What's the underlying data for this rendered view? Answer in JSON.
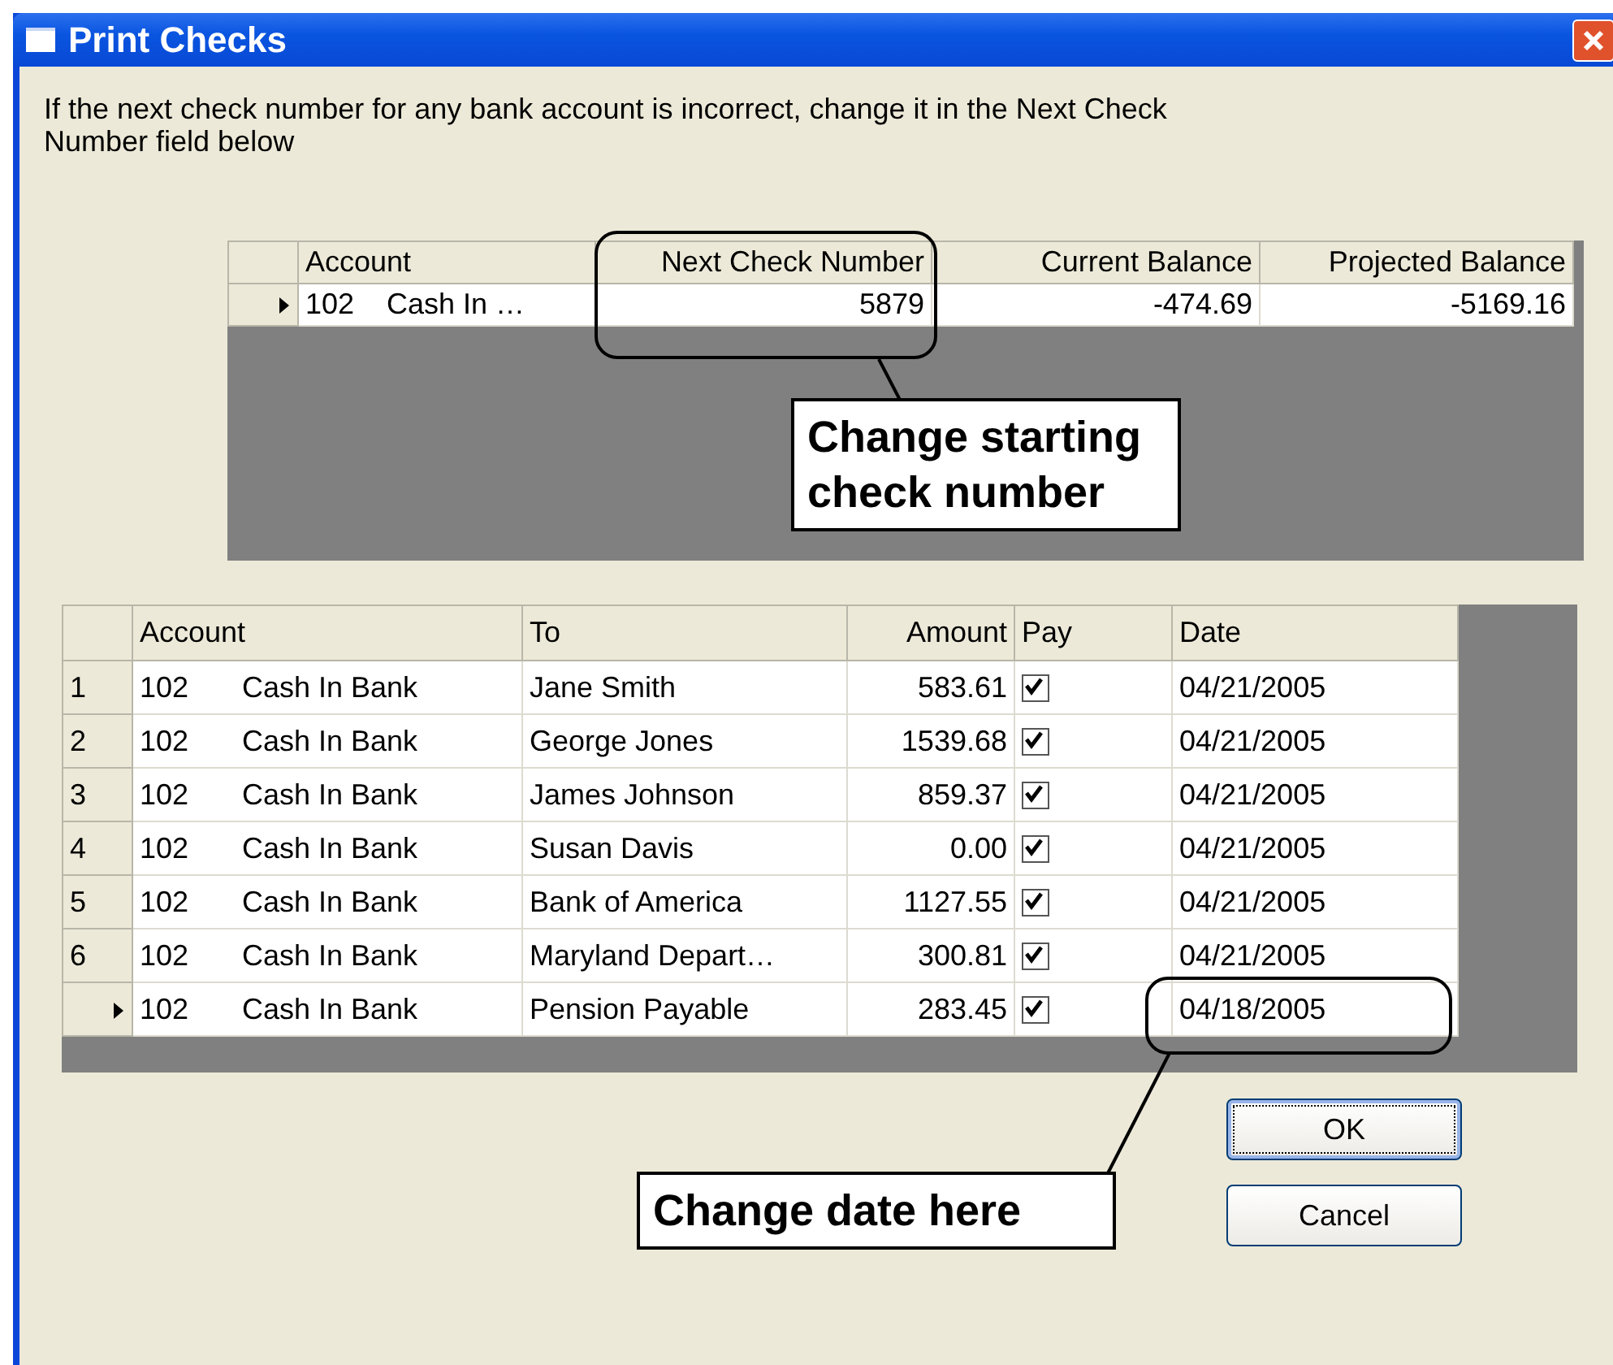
{
  "window": {
    "title": "Print Checks"
  },
  "instructions": "If the next check number for any bank account is incorrect, change it in the Next Check Number field below",
  "accounts_grid": {
    "columns": [
      {
        "label": "Account",
        "kind": "account"
      },
      {
        "label": "Next Check Number",
        "kind": "number"
      },
      {
        "label": "Current Balance",
        "kind": "number"
      },
      {
        "label": "Projected Balance",
        "kind": "number"
      }
    ],
    "rows": [
      {
        "current": true,
        "cells": [
          [
            "102",
            "Cash In …"
          ],
          "5879",
          "-474.69",
          "-5169.16"
        ]
      }
    ]
  },
  "checks_grid": {
    "columns": [
      {
        "label": "Account",
        "kind": "account"
      },
      {
        "label": "To",
        "kind": "text"
      },
      {
        "label": "Amount",
        "kind": "number"
      },
      {
        "label": "Pay",
        "kind": "check"
      },
      {
        "label": "Date",
        "kind": "text"
      }
    ],
    "rows": [
      {
        "number": "1",
        "current": false,
        "cells": [
          [
            "102",
            "Cash In Bank"
          ],
          "Jane Smith",
          "583.61",
          true,
          "04/21/2005"
        ]
      },
      {
        "number": "2",
        "current": false,
        "cells": [
          [
            "102",
            "Cash In Bank"
          ],
          "George Jones",
          "1539.68",
          true,
          "04/21/2005"
        ]
      },
      {
        "number": "3",
        "current": false,
        "cells": [
          [
            "102",
            "Cash In Bank"
          ],
          "James Johnson",
          "859.37",
          true,
          "04/21/2005"
        ]
      },
      {
        "number": "4",
        "current": false,
        "cells": [
          [
            "102",
            "Cash In Bank"
          ],
          "Susan Davis",
          "0.00",
          true,
          "04/21/2005"
        ]
      },
      {
        "number": "5",
        "current": false,
        "cells": [
          [
            "102",
            "Cash In Bank"
          ],
          "Bank of America",
          "1127.55",
          true,
          "04/21/2005"
        ]
      },
      {
        "number": "6",
        "current": false,
        "cells": [
          [
            "102",
            "Cash In Bank"
          ],
          "Maryland Depart…",
          "300.81",
          true,
          "04/21/2005"
        ]
      },
      {
        "current": true,
        "cells": [
          [
            "102",
            "Cash In Bank"
          ],
          "Pension Payable",
          "283.45",
          true,
          "04/18/2005"
        ]
      }
    ]
  },
  "callouts": [
    {
      "text": "Change starting check number"
    },
    {
      "text": "Change date here"
    }
  ],
  "buttons": [
    {
      "label": "OK",
      "default": true
    },
    {
      "label": "Cancel",
      "default": false
    }
  ]
}
